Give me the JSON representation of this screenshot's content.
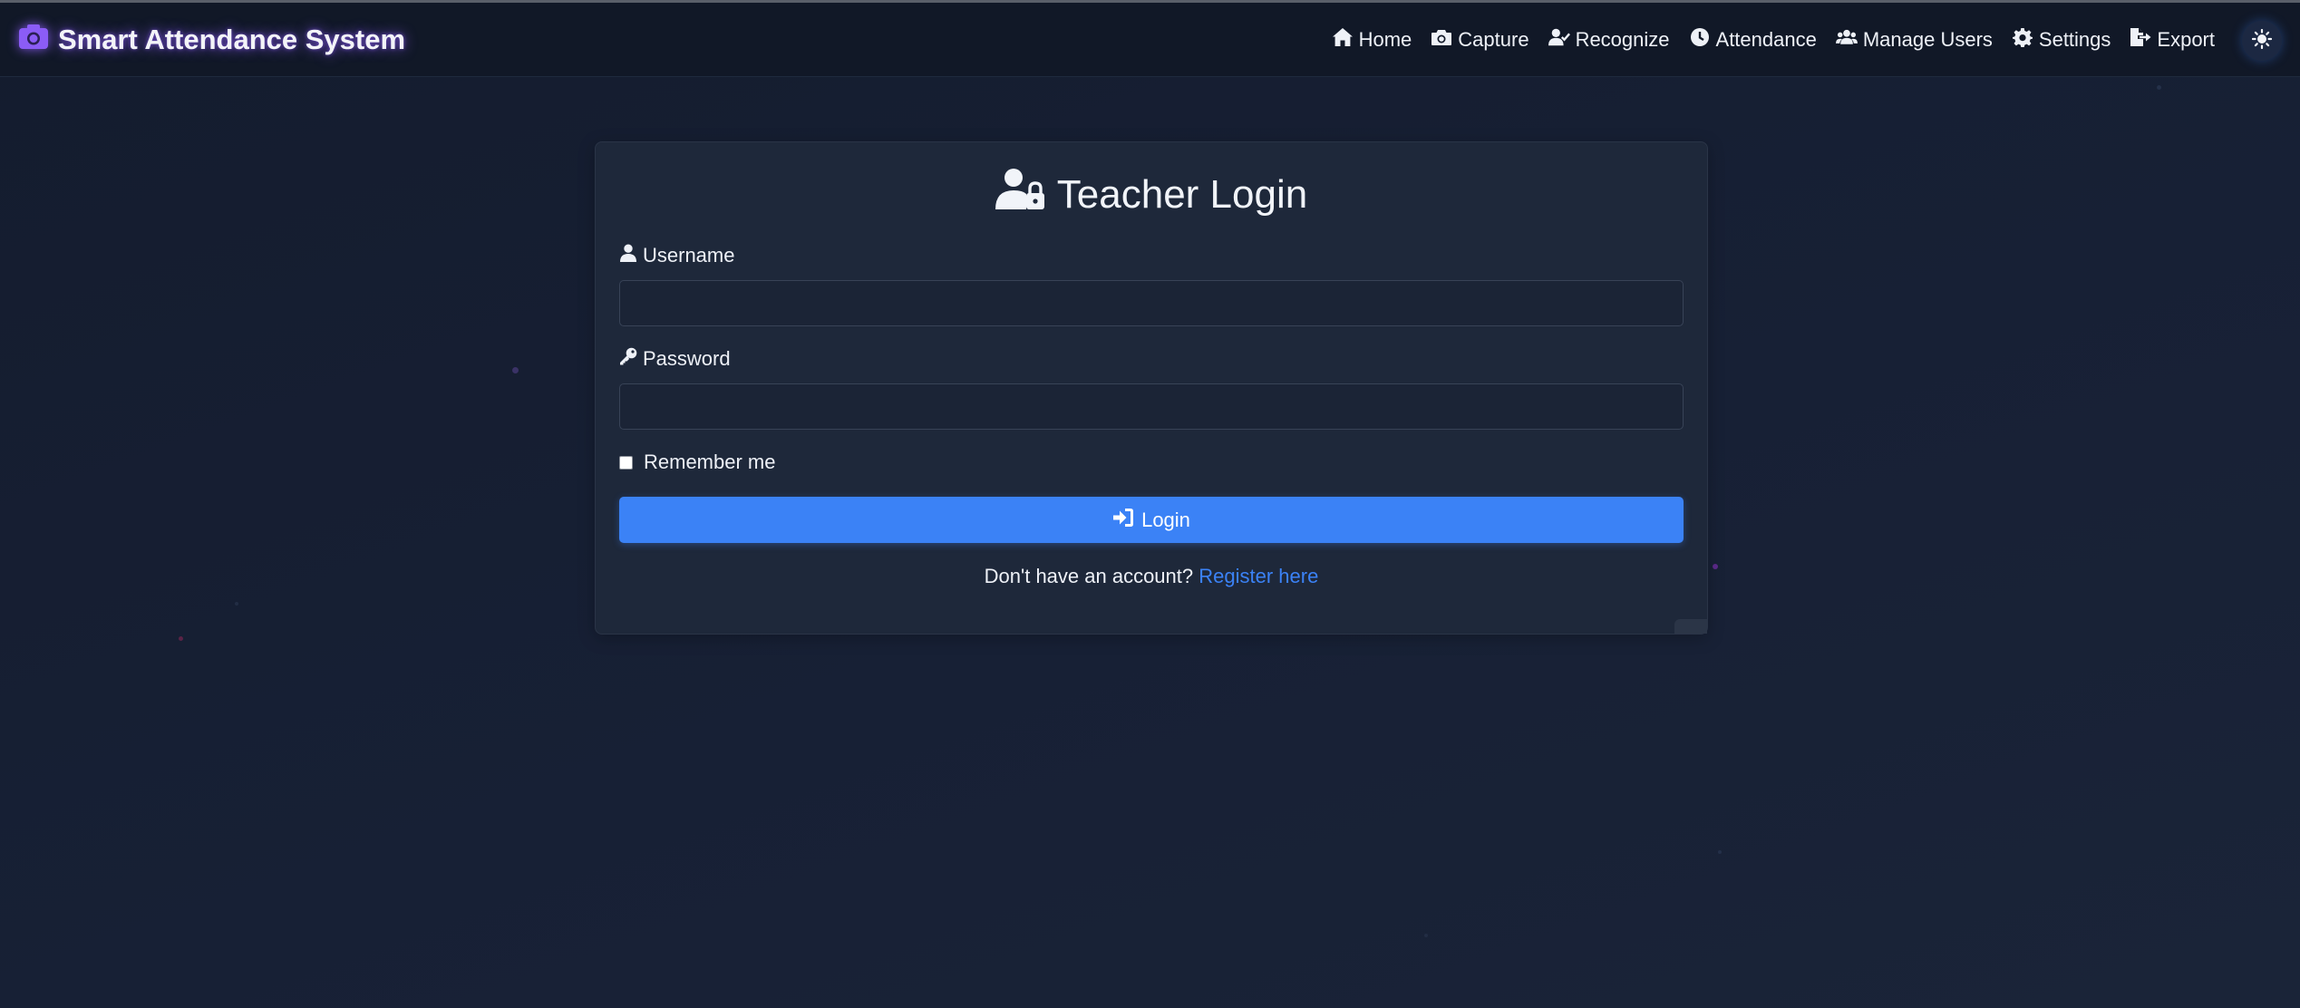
{
  "app": {
    "title": "Smart Attendance System",
    "logo_icon": "camera-icon"
  },
  "nav": {
    "items": [
      {
        "label": "Home",
        "icon": "home-icon"
      },
      {
        "label": "Capture",
        "icon": "camera-icon"
      },
      {
        "label": "Recognize",
        "icon": "user-check-icon"
      },
      {
        "label": "Attendance",
        "icon": "clock-icon"
      },
      {
        "label": "Manage Users",
        "icon": "users-icon"
      },
      {
        "label": "Settings",
        "icon": "gear-icon"
      },
      {
        "label": "Export",
        "icon": "file-export-icon"
      }
    ],
    "theme_toggle_icon": "sun-icon"
  },
  "login": {
    "title": "Teacher Login",
    "title_icon": "user-lock-icon",
    "username_label": "Username",
    "username_value": "",
    "password_label": "Password",
    "password_value": "",
    "remember_label": "Remember me",
    "remember_checked": false,
    "login_button": "Login",
    "register_prompt": "Don't have an account?",
    "register_link": "Register here"
  },
  "colors": {
    "background": "#172035",
    "navbar": "#111827",
    "card": "#1e283a",
    "accent": "#3b82f6",
    "brand_glow": "#8b5cf6"
  }
}
